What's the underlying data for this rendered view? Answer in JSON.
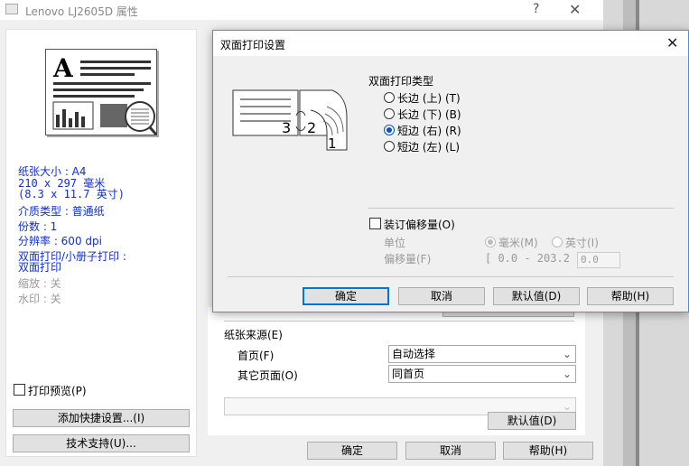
{
  "parent": {
    "title": "Lenovo LJ2605D 属性",
    "help": "?",
    "close": "✕",
    "info": {
      "paper_size": "纸张大小 : A4",
      "paper_dims_mm": "210 x 297 毫米",
      "paper_dims_in": "(8.3 x 11.7 英寸)",
      "media_type": "介质类型 : 普通纸",
      "copies": "份数 : 1",
      "resolution": "分辨率 : 600 dpi",
      "duplex_label": "双面打印/小册子打印 :",
      "duplex_value": "双面打印",
      "scaling": "缩放 : 关",
      "watermark": "水印 : 关"
    },
    "print_preview_label": "打印预览(P)",
    "add_shortcut_label": "添加快捷设置...(I)",
    "tech_support_label": "技术支持(U)...",
    "paper_source_label": "纸张来源(E)",
    "first_page_label": "首页(F)",
    "first_page_value": "自动选择",
    "other_pages_label": "其它页面(O)",
    "other_pages_value": "同首页",
    "defaults_label": "默认值(D)",
    "ok_label": "确定",
    "cancel_label": "取消",
    "help_label": "帮助(H)"
  },
  "dialog": {
    "title": "双面打印设置",
    "close": "✕",
    "duplex_type_label": "双面打印类型",
    "options": [
      {
        "label": "长边 (上) (T)",
        "selected": false
      },
      {
        "label": "长边 (下) (B)",
        "selected": false
      },
      {
        "label": "短边 (右) (R)",
        "selected": true
      },
      {
        "label": "短边 (左) (L)",
        "selected": false
      }
    ],
    "binding_offset_label": "装订偏移量(O)",
    "unit_label": "单位",
    "unit_mm_label": "毫米(M)",
    "unit_inch_label": "英寸(I)",
    "offset_label": "偏移量(F)",
    "offset_range": "[ 0.0 - 203.2 ]",
    "offset_value": "0.0",
    "ok_label": "确定",
    "cancel_label": "取消",
    "defaults_label": "默认值(D)",
    "help_label": "帮助(H)"
  }
}
